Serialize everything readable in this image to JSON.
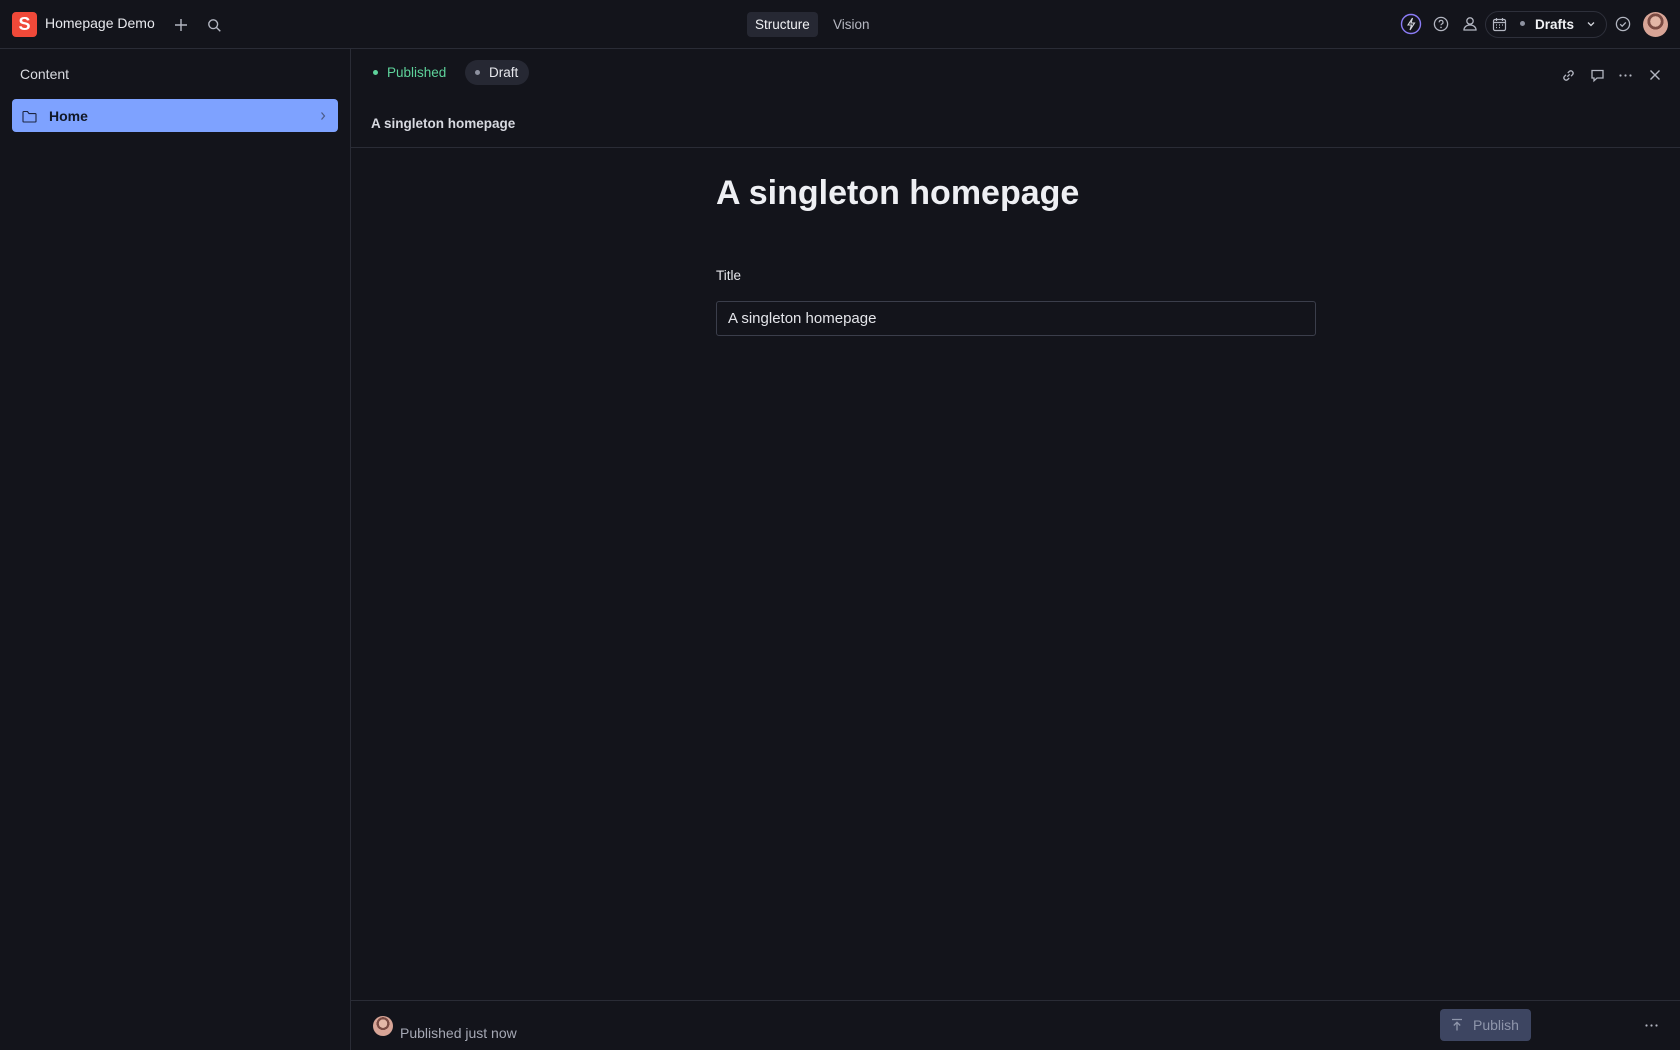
{
  "app": {
    "logo_letter": "S",
    "title": "Homepage Demo",
    "brand_color": "#f04939"
  },
  "header": {
    "tabs": [
      {
        "label": "Structure",
        "active": true
      },
      {
        "label": "Vision",
        "active": false
      }
    ],
    "perspective_label": "Drafts",
    "icons": [
      "add-icon",
      "search-icon",
      "ai-bolt-icon",
      "help-icon",
      "people-icon",
      "calendar-icon",
      "chevron-down-icon",
      "check-circle-icon",
      "avatar"
    ]
  },
  "sidebar": {
    "heading": "Content",
    "items": [
      {
        "label": "Home",
        "icon": "folder-icon",
        "selected": true
      }
    ],
    "selected_color": "#7ea2ff"
  },
  "document": {
    "status_tabs": [
      {
        "label": "Published",
        "color": "#5ed39b"
      },
      {
        "label": "Draft",
        "color": "#8e92a0"
      }
    ],
    "breadcrumb": "A singleton homepage",
    "title": "A singleton homepage",
    "fields": {
      "title_label": "Title",
      "title_value": "A singleton homepage"
    },
    "footer": {
      "status_text": "Published just now",
      "publish_label": "Publish"
    }
  }
}
